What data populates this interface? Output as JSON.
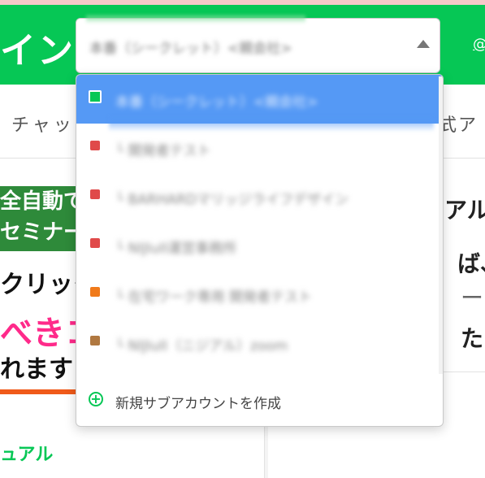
{
  "header": {
    "brand": "イン",
    "right_link": "@"
  },
  "subnav": {
    "left": "チャッ",
    "right": "式ア"
  },
  "left_panel": {
    "banner": {
      "green_line1": "全自動で",
      "green_line2": "セミナー",
      "line1": "クリック",
      "line2": "べきコ",
      "line3": "れます"
    },
    "bottom_link": "ュアル"
  },
  "right_panel": {
    "line1": "アル",
    "line2": "ば、",
    "line3": "ー",
    "line4": "たり"
  },
  "select": {
    "current_value": "本番（シークレット）<親会社>"
  },
  "dropdown": {
    "options": [
      {
        "label": "本番（シークレット）<親会社>",
        "color": "#06c755",
        "active": true
      },
      {
        "label": "└ 開発者テスト",
        "color": "#e04a4a",
        "active": false
      },
      {
        "label": "└ BARHARDマリッジライフデザイン",
        "color": "#e04a4a",
        "active": false
      },
      {
        "label": "└ NIJIuII運営事務所",
        "color": "#e04a4a",
        "active": false
      },
      {
        "label": "└ 在宅ワーク専用 開発者テスト",
        "color": "#f07a1a",
        "active": false
      },
      {
        "label": "└ NIJIuII（ニジアル）zoom",
        "color": "#b07840",
        "active": false
      }
    ],
    "footer": {
      "plus_glyph": "+",
      "label": "新規サブアカウントを作成"
    }
  }
}
